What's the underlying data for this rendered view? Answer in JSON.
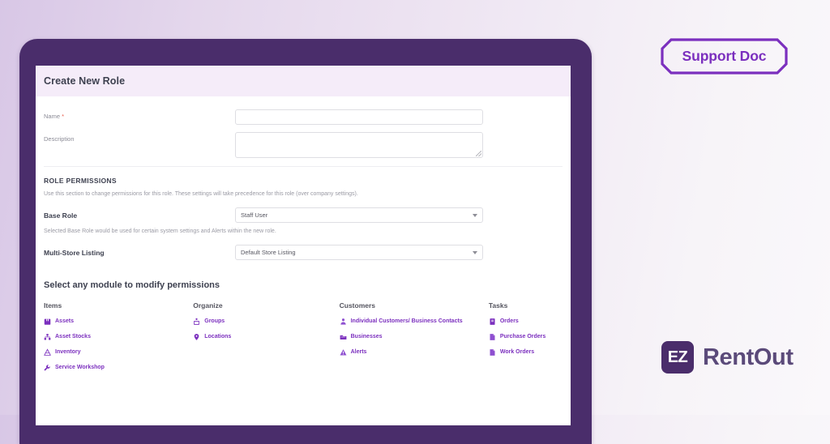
{
  "badge": {
    "label": "Support Doc",
    "color": "#7b2fbe"
  },
  "brand": {
    "mark": "EZ",
    "name": "RentOut",
    "mark_bg": "#4a2d6b"
  },
  "card": {
    "title": "Create New Role",
    "header_bg": "#f5ecf9"
  },
  "form": {
    "fields": [
      {
        "label": "Name",
        "required": true,
        "value": "",
        "placeholder": ""
      },
      {
        "label": "Description",
        "required": false,
        "value": "",
        "placeholder": ""
      }
    ]
  },
  "permissions": {
    "section_title": "ROLE PERMISSIONS",
    "helper_text": "Use this section to change permissions for this role. These settings will take precedence for this role (over company settings).",
    "base_role": {
      "label": "Base Role",
      "value": "Staff User",
      "note": "Selected Base Role would be used for certain system settings and Alerts within the new role."
    },
    "multi_store": {
      "label": "Multi-Store Listing",
      "value": "Default Store Listing"
    }
  },
  "modules": {
    "title": "Select any module to modify permissions",
    "accent": "#7b2fbe",
    "columns": [
      {
        "heading": "Items",
        "items": [
          {
            "label": "Assets",
            "icon": "assets-icon"
          },
          {
            "label": "Asset Stocks",
            "icon": "asset-stocks-icon"
          },
          {
            "label": "Inventory",
            "icon": "inventory-icon"
          },
          {
            "label": "Service Workshop",
            "icon": "service-workshop-icon"
          }
        ]
      },
      {
        "heading": "Organize",
        "items": [
          {
            "label": "Groups",
            "icon": "groups-icon"
          },
          {
            "label": "Locations",
            "icon": "locations-icon"
          }
        ]
      },
      {
        "heading": "Customers",
        "items": [
          {
            "label": "Individual Customers/ Business Contacts",
            "icon": "individual-customers-icon"
          },
          {
            "label": "Businesses",
            "icon": "businesses-icon"
          },
          {
            "label": "Alerts",
            "icon": "alerts-icon"
          }
        ]
      },
      {
        "heading": "Tasks",
        "items": [
          {
            "label": "Orders",
            "icon": "orders-icon"
          },
          {
            "label": "Purchase Orders",
            "icon": "purchase-orders-icon"
          },
          {
            "label": "Work Orders",
            "icon": "work-orders-icon"
          }
        ]
      }
    ]
  }
}
